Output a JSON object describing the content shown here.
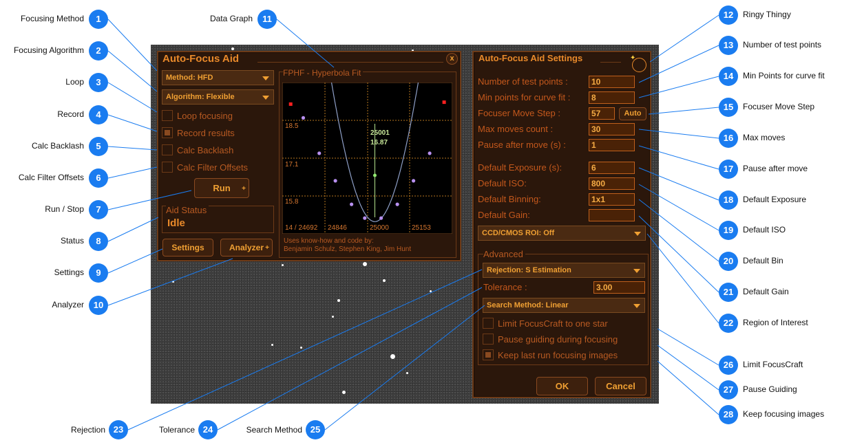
{
  "callouts": {
    "c1": "Focusing Method",
    "c2": "Focusing Algorithm",
    "c3": "Loop",
    "c4": "Record",
    "c5": "Calc Backlash",
    "c6": "Calc Filter Offsets",
    "c7": "Run / Stop",
    "c8": "Status",
    "c9": "Settings",
    "c10": "Analyzer",
    "c11": "Data Graph",
    "c12": "Ringy Thingy",
    "c13": "Number of test points",
    "c14": "Min Points for curve fit",
    "c15": "Focuser Move Step",
    "c16": "Max moves",
    "c17": "Pause after move",
    "c18": "Default Exposure",
    "c19": "Default ISO",
    "c20": "Default Bin",
    "c21": "Default Gain",
    "c22": "Region of Interest",
    "c23": "Rejection",
    "c24": "Tolerance",
    "c25": "Search Method",
    "c26": "Limit FocusCraft",
    "c27": "Pause Guiding",
    "c28": "Keep focusing images"
  },
  "numbers": {
    "n1": "1",
    "n2": "2",
    "n3": "3",
    "n4": "4",
    "n5": "5",
    "n6": "6",
    "n7": "7",
    "n8": "8",
    "n9": "9",
    "n10": "10",
    "n11": "11",
    "n12": "12",
    "n13": "13",
    "n14": "14",
    "n15": "15",
    "n16": "16",
    "n17": "17",
    "n18": "18",
    "n19": "19",
    "n20": "20",
    "n21": "21",
    "n22": "22",
    "n23": "23",
    "n24": "24",
    "n25": "25",
    "n26": "26",
    "n27": "27",
    "n28": "28"
  },
  "aid": {
    "title": "Auto-Focus Aid",
    "close": "x",
    "method": "Method: HFD",
    "algorithm": "Algorithm: Flexible",
    "loop": "Loop focusing",
    "record": "Record results",
    "backlash": "Calc Backlash",
    "filter_offsets": "Calc Filter Offsets",
    "run": "Run",
    "status_title": "Aid Status",
    "status_value": "Idle",
    "settings": "Settings",
    "analyzer": "Analyzer",
    "plus": "+"
  },
  "graph": {
    "title": "FPHF - Hyperbola Fit",
    "y_labels": [
      "18.5",
      "17.1",
      "15.8"
    ],
    "x_labels": [
      "14 / 24692",
      "24846",
      "25000",
      "25153"
    ],
    "readout_x": "25001",
    "readout_y": "16.87",
    "credits_1": "Uses know-how and code by:",
    "credits_2": "Benjamin Schulz, Stephen King, Jim Hunt"
  },
  "settings": {
    "title": "Auto-Focus Aid Settings",
    "ring_icon": "ring-icon",
    "test_points_label": "Number of test points :",
    "test_points": "10",
    "min_points_label": "Min points for curve fit :",
    "min_points": "8",
    "move_step_label": "Focuser Move Step :",
    "move_step": "57",
    "auto": "Auto",
    "max_moves_label": "Max moves count :",
    "max_moves": "30",
    "pause_label": "Pause after move (s) :",
    "pause": "1",
    "exposure_label": "Default Exposure (s):",
    "exposure": "6",
    "iso_label": "Default ISO:",
    "iso": "800",
    "binning_label": "Default Binning:",
    "binning": "1x1",
    "gain_label": "Default Gain:",
    "gain": "",
    "roi": "CCD/CMOS ROI: Off",
    "advanced": "Advanced",
    "rejection": "Rejection: S Estimation",
    "tolerance_label": "Tolerance :",
    "tolerance": "3.00",
    "search": "Search Method: Linear",
    "limit": "Limit FocusCraft to one star",
    "pause_guiding": "Pause guiding during focusing",
    "keep_images": "Keep last run focusing images",
    "ok": "OK",
    "cancel": "Cancel"
  },
  "colors": {
    "panel_bg": "#2b170b",
    "accent": "#e8892a",
    "badge": "#1a7cf0"
  },
  "chart_data": {
    "type": "scatter",
    "title": "FPHF - Hyperbola Fit",
    "x_ticks": [
      "24692",
      "24846",
      "25000",
      "25153"
    ],
    "y_ticks": [
      "18.5",
      "17.1",
      "15.8"
    ],
    "focus_position": 25001,
    "min_hfd": 16.87,
    "series": [
      {
        "points": [
          {
            "x": 24660,
            "y": 18.5
          },
          {
            "x": 24736,
            "y": 17.6
          },
          {
            "x": 24813,
            "y": 16.9
          },
          {
            "x": 24890,
            "y": 16.3
          },
          {
            "x": 24953,
            "y": 15.95
          },
          {
            "x": 25031,
            "y": 15.95
          },
          {
            "x": 25108,
            "y": 16.3
          },
          {
            "x": 25185,
            "y": 16.9
          },
          {
            "x": 25262,
            "y": 17.6
          }
        ]
      }
    ],
    "rejected_points": [
      {
        "x": 24600,
        "y": 18.85
      },
      {
        "x": 25331,
        "y": 18.9
      }
    ]
  }
}
